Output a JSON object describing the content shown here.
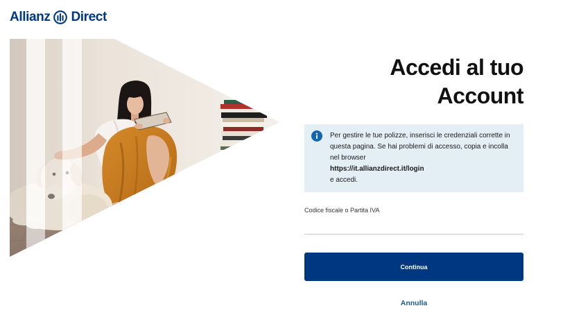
{
  "header": {
    "brand_left": "Allianz",
    "brand_right": "Direct",
    "logo_icon": "allianz-logo-icon"
  },
  "login": {
    "title": "Accedi al tuo Account",
    "info_box": {
      "icon": "info-icon",
      "message": "Per gestire le tue polizze, inserisci le credenziali corrette in questa pagina. Se hai problemi di accesso, copia e incolla nel browser",
      "login_url": "https://it.allianzdirect.it/login",
      "message_end": "e accedi."
    },
    "tax_code_field": {
      "label": "Codice fiscale o Partita IVA",
      "value": "",
      "placeholder": ""
    },
    "continue_button": "Continua",
    "cancel_link": "Annulla"
  },
  "colors": {
    "brand_blue": "#003781",
    "info_background": "#e4eef5",
    "info_icon": "#1366ad",
    "cancel_link": "#1a5a9a",
    "title_text": "#111111",
    "field_border": "#c9c9c9"
  }
}
